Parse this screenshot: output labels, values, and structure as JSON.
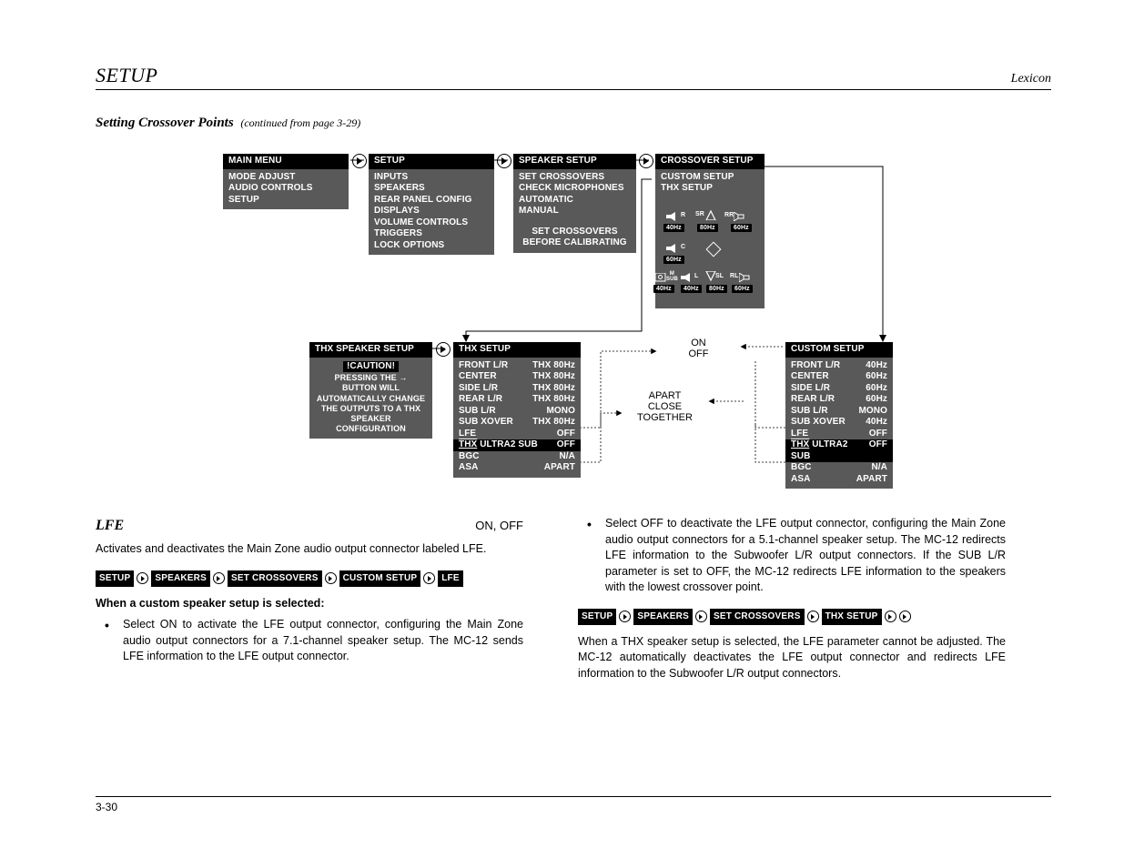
{
  "header": {
    "left": "SETUP",
    "right": "Lexicon"
  },
  "subtitle": {
    "bold": "Setting Crossover Points",
    "cont": "(continued from page 3-29)"
  },
  "panels": {
    "main_menu": {
      "title": "MAIN MENU",
      "items": [
        "MODE ADJUST",
        "AUDIO CONTROLS",
        "SETUP"
      ]
    },
    "setup": {
      "title": "SETUP",
      "items": [
        "INPUTS",
        "SPEAKERS",
        "REAR PANEL CONFIG",
        "DISPLAYS",
        "VOLUME CONTROLS",
        "TRIGGERS",
        "LOCK OPTIONS"
      ]
    },
    "speaker_setup": {
      "title": "SPEAKER SETUP",
      "items": [
        "SET CROSSOVERS",
        "CHECK MICROPHONES",
        "AUTOMATIC",
        "MANUAL"
      ],
      "footer1": "SET CROSSOVERS",
      "footer2": "BEFORE CALIBRATING"
    },
    "crossover_setup": {
      "title": "CROSSOVER SETUP",
      "items": [
        "CUSTOM SETUP",
        "THX SETUP"
      ]
    },
    "thx_spk": {
      "title": "THX SPEAKER SETUP",
      "caution": "!CAUTION!",
      "body": [
        "PRESSING THE →",
        "BUTTON WILL",
        "AUTOMATICALLY CHANGE",
        "THE OUTPUTS TO A THX",
        "SPEAKER",
        "CONFIGURATION"
      ]
    },
    "thx_setup": {
      "title": "THX SETUP",
      "rows": [
        [
          "FRONT L/R",
          "THX 80Hz"
        ],
        [
          "CENTER",
          "THX 80Hz"
        ],
        [
          "SIDE L/R",
          "THX 80Hz"
        ],
        [
          "REAR L/R",
          "THX 80Hz"
        ],
        [
          "SUB L/R",
          "MONO"
        ],
        [
          "SUB XOVER",
          "THX 80Hz"
        ],
        [
          "LFE",
          "OFF"
        ]
      ],
      "highlight": [
        "THX ULTRA2 SUB",
        "OFF"
      ],
      "rows2": [
        [
          "BGC",
          "N/A"
        ],
        [
          "ASA",
          "APART"
        ]
      ]
    },
    "custom_setup": {
      "title": "CUSTOM SETUP",
      "rows": [
        [
          "FRONT L/R",
          "40Hz"
        ],
        [
          "CENTER",
          "60Hz"
        ],
        [
          "SIDE L/R",
          "60Hz"
        ],
        [
          "REAR L/R",
          "60Hz"
        ],
        [
          "SUB L/R",
          "MONO"
        ],
        [
          "SUB XOVER",
          "40Hz"
        ],
        [
          "LFE",
          "OFF"
        ]
      ],
      "highlight": [
        "THX ULTRA2 SUB",
        "OFF"
      ],
      "rows2": [
        [
          "BGC",
          "N/A"
        ],
        [
          "ASA",
          "APART"
        ]
      ]
    },
    "onoff_menu": [
      "ON",
      "OFF"
    ],
    "spacing_menu": [
      "APART",
      "CLOSE",
      "TOGETHER"
    ]
  },
  "crossover_diagram": {
    "row1": [
      {
        "label": "R",
        "freq": "40Hz"
      },
      {
        "label": "SR",
        "freq": "80Hz"
      },
      {
        "label": "RR",
        "freq": "60Hz"
      }
    ],
    "row2": [
      {
        "label": "C",
        "freq": "60Hz"
      }
    ],
    "row3": [
      {
        "label": "M SUB",
        "freq": "40Hz"
      },
      {
        "label": "L",
        "freq": "40Hz"
      },
      {
        "label": "SL",
        "freq": "80Hz"
      },
      {
        "label": "RL",
        "freq": "60Hz"
      }
    ]
  },
  "body": {
    "lfe": {
      "title": "LFE",
      "vals": "ON, OFF"
    },
    "p1": "Activates and deactivates the Main Zone audio output connector labeled LFE.",
    "bc1": [
      "SETUP",
      "SPEAKERS",
      "SET CROSSOVERS",
      "CUSTOM SETUP",
      "LFE"
    ],
    "bold1": "When a custom speaker setup is selected:",
    "li1": "Select ON to activate the LFE output connector, configuring the Main Zone audio output connectors for a 7.1-channel speaker setup. The MC-12 sends LFE information to the LFE output connector.",
    "li2": "Select OFF to deactivate the LFE output connector, configuring the Main Zone audio output connectors for a 5.1-channel speaker setup. The MC-12 redirects LFE information to the Subwoofer L/R output connectors. If the SUB L/R parameter is set to OFF, the MC-12 redirects LFE information to the speakers with the lowest crossover point.",
    "bc2": [
      "SETUP",
      "SPEAKERS",
      "SET CROSSOVERS",
      "THX SETUP",
      ""
    ],
    "p2": "When a THX speaker setup is selected, the LFE parameter cannot be adjusted. The MC-12 automatically deactivates the LFE output connector and redirects LFE information to the Subwoofer L/R output connectors."
  },
  "footer": {
    "page": "3-30"
  }
}
